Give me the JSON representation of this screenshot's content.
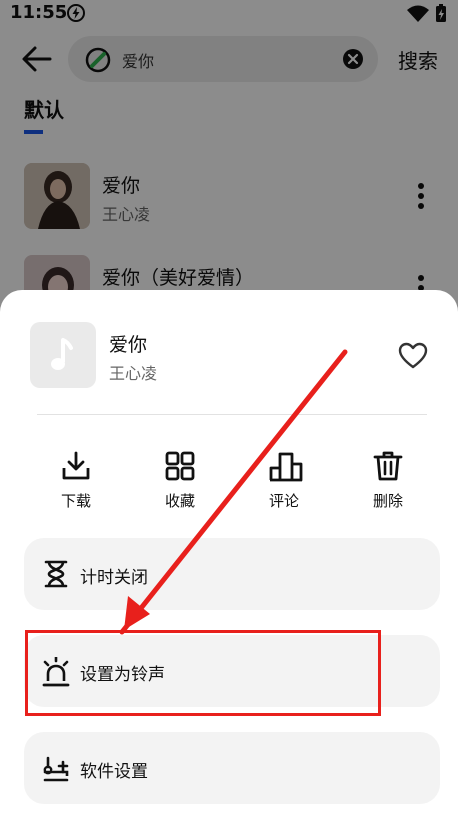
{
  "status_bar": {
    "time": "11:55"
  },
  "header": {
    "search_value": "爱你",
    "search_button": "搜索"
  },
  "tabs": {
    "default": "默认"
  },
  "songs": [
    {
      "title": "爱你",
      "artist": "王心凌"
    },
    {
      "title": "爱你（美好爱情）"
    }
  ],
  "sheet": {
    "title": "爱你",
    "artist": "王心凌",
    "actions": [
      {
        "label": "下载",
        "icon": "download-icon"
      },
      {
        "label": "收藏",
        "icon": "grid-icon"
      },
      {
        "label": "评论",
        "icon": "podium-icon"
      },
      {
        "label": "删除",
        "icon": "trash-icon"
      }
    ],
    "menu": [
      {
        "label": "计时关闭",
        "icon": "hourglass-icon"
      },
      {
        "label": "设置为铃声",
        "icon": "alarm-bell-icon"
      },
      {
        "label": "软件设置",
        "icon": "settings-slider-icon"
      }
    ]
  },
  "colors": {
    "tab_accent": "#1a56e8",
    "annotation": "#e8201c",
    "menu_card": "#f3f3f3"
  }
}
